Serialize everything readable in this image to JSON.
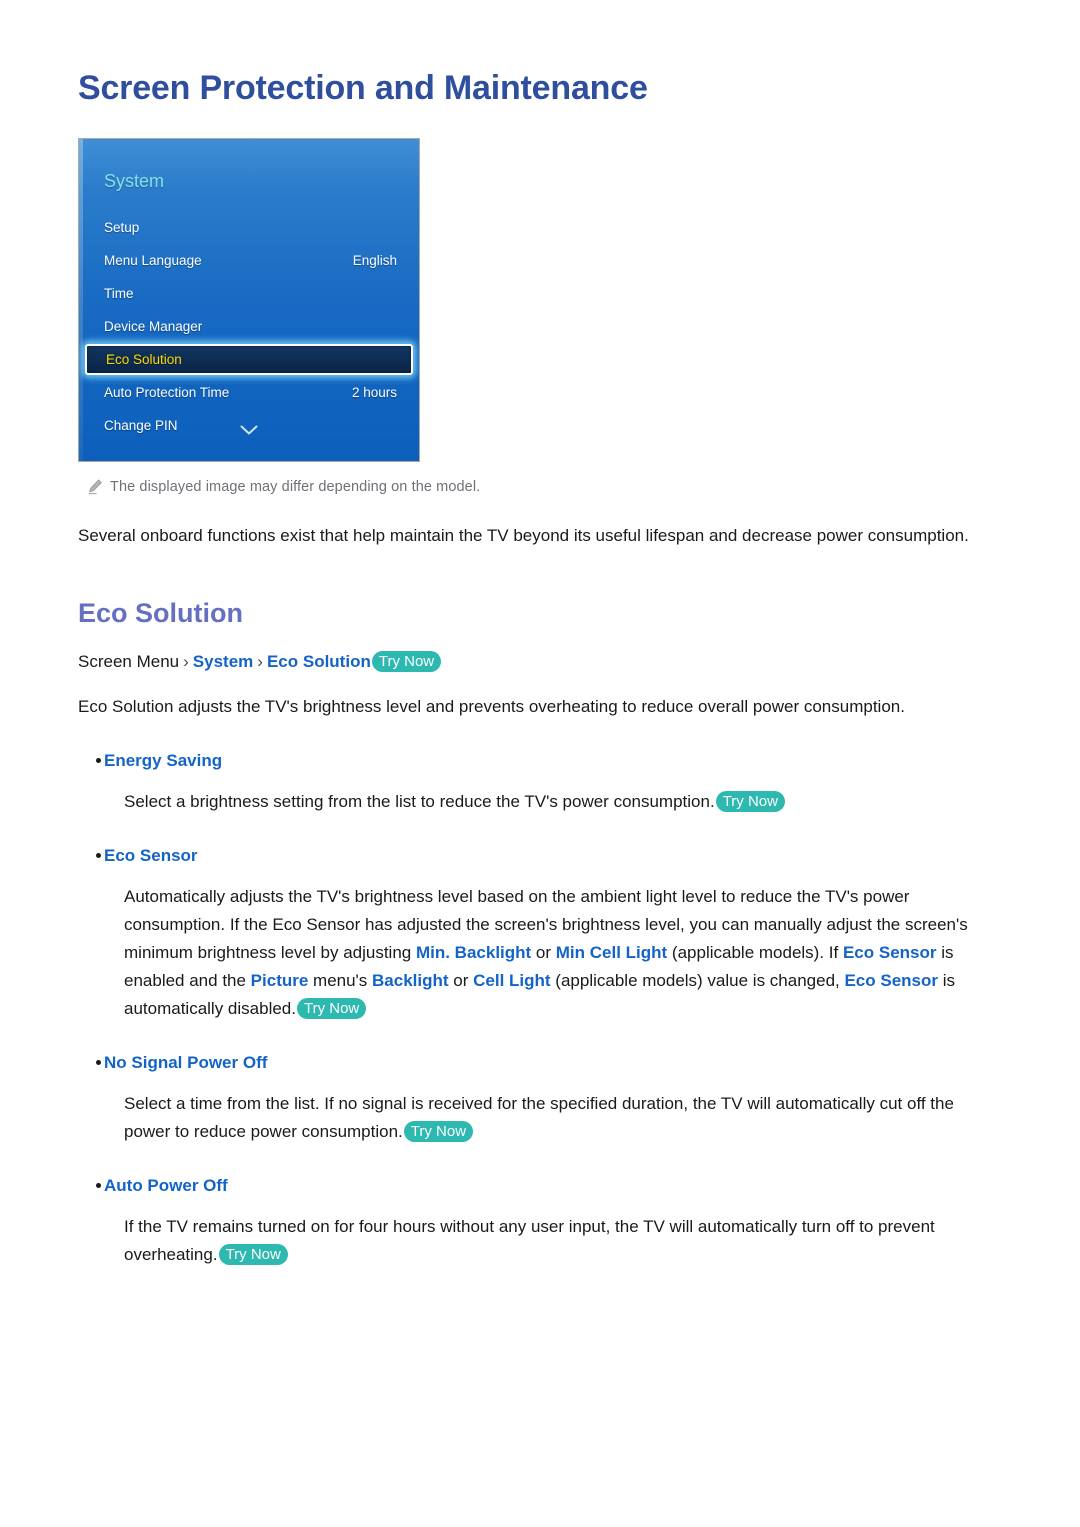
{
  "page": {
    "title": "Screen Protection and Maintenance"
  },
  "tv_menu": {
    "header": "System",
    "rows": [
      {
        "label": "Setup",
        "value": ""
      },
      {
        "label": "Menu Language",
        "value": "English"
      },
      {
        "label": "Time",
        "value": ""
      },
      {
        "label": "Device Manager",
        "value": ""
      },
      {
        "label": "Eco Solution",
        "value": "",
        "selected": true
      },
      {
        "label": "Auto Protection Time",
        "value": "2 hours"
      },
      {
        "label": "Change PIN",
        "value": ""
      }
    ],
    "scroll_icon": "chevron-down-icon"
  },
  "note": {
    "icon": "pencil-icon",
    "text": "The displayed image may differ depending on the model."
  },
  "lead_paragraph": "Several onboard functions exist that help maintain the TV beyond its useful lifespan and decrease power consumption.",
  "section": {
    "heading": "Eco Solution",
    "breadcrumb": {
      "prefix": "Screen Menu",
      "separator": "›",
      "link1": "System",
      "link2": "Eco Solution",
      "try_now": "Try Now"
    },
    "intro": "Eco Solution adjusts the TV's brightness level and prevents overheating to reduce overall power consumption."
  },
  "bullets": [
    {
      "label": "Energy Saving",
      "body_1": "Select a brightness setting from the list to reduce the TV's power consumption.",
      "try_now": "Try Now"
    },
    {
      "label": "Eco Sensor",
      "body_1": "Automatically adjusts the TV's brightness level based on the ambient light level to reduce the TV's power consumption. If the Eco Sensor has adjusted the screen's brightness level, you can manually adjust the screen's minimum brightness level by adjusting ",
      "term_1": "Min. Backlight",
      "body_2": " or ",
      "term_2": "Min Cell Light",
      "body_3": " (applicable models). If ",
      "term_3": "Eco Sensor",
      "body_4": " is enabled and the ",
      "term_4": "Picture",
      "body_5": " menu's ",
      "term_5": "Backlight",
      "body_6": " or ",
      "term_6": "Cell Light",
      "body_7": " (applicable models) value is changed, ",
      "term_7": "Eco Sensor",
      "body_8": " is automatically disabled.",
      "try_now": "Try Now"
    },
    {
      "label": "No Signal Power Off",
      "body_1": "Select a time from the list. If no signal is received for the specified duration, the TV will automatically cut off the power to reduce power consumption.",
      "try_now": "Try Now"
    },
    {
      "label": "Auto Power Off",
      "body_1": "If the TV remains turned on for four hours without any user input, the TV will automatically turn off to prevent overheating.",
      "try_now": "Try Now"
    }
  ],
  "colors": {
    "title_blue": "#2f4f9e",
    "heading_purple": "#6670c0",
    "link_blue": "#1464c8",
    "try_now_teal": "#2db8b0",
    "menu_selected_text": "#ffd800",
    "menu_header_cyan": "#7fe3e8"
  }
}
